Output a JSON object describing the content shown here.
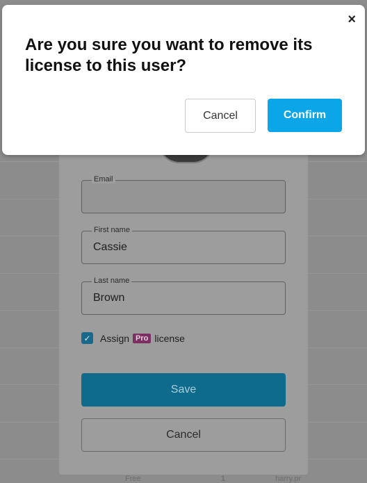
{
  "modal": {
    "question": "Are you sure you want to remove its license to this user?",
    "close_label": "×",
    "cancel_label": "Cancel",
    "confirm_label": "Confirm",
    "confirm_color": "#0aa6e8"
  },
  "form": {
    "email": {
      "label": "Email",
      "value": ""
    },
    "first_name": {
      "label": "First name",
      "value": "Cassie"
    },
    "last_name": {
      "label": "Last name",
      "value": "Brown"
    },
    "assign": {
      "prefix": "Assign",
      "badge": "Pro",
      "suffix": "license",
      "checked": true
    },
    "save_label": "Save",
    "cancel_label": "Cancel"
  },
  "background_row": {
    "plan": "Free",
    "count": "1",
    "user": "harry.pr"
  },
  "icons": {
    "close": "close-icon",
    "check": "checkbox-check-icon"
  }
}
